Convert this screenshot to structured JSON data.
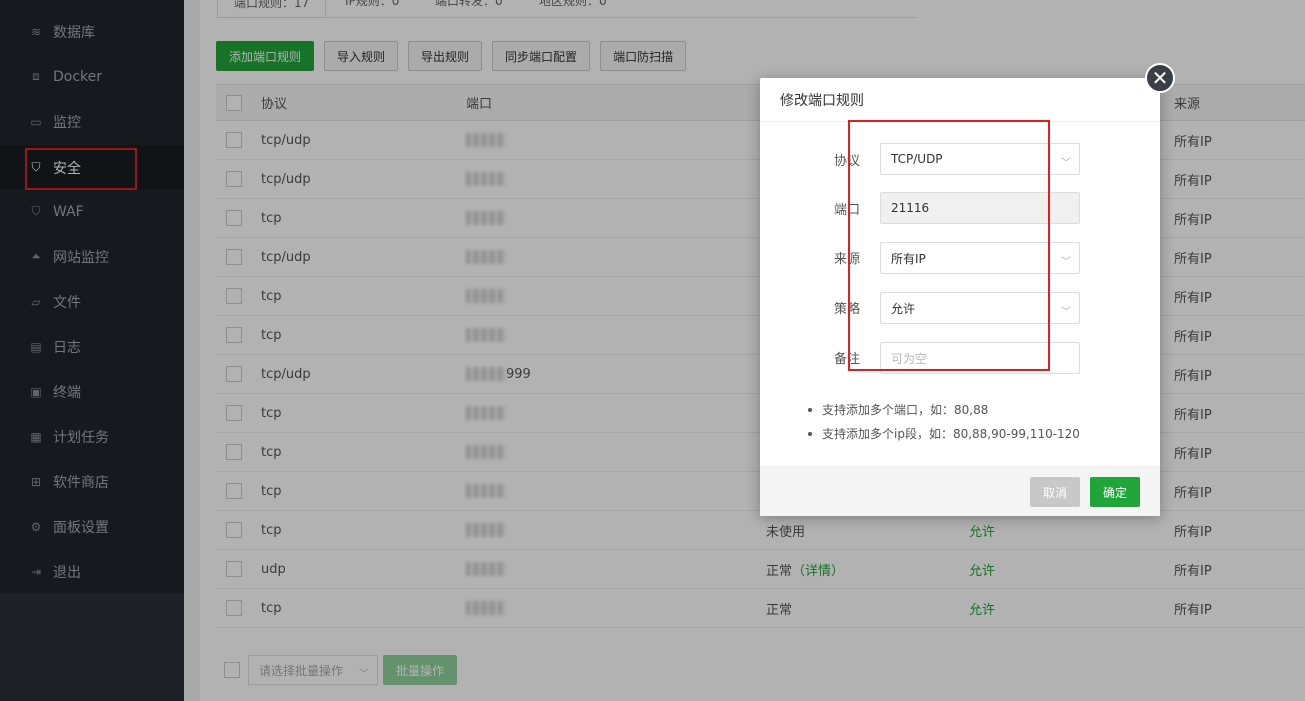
{
  "sidebar": {
    "items": [
      {
        "label": "数据库",
        "icon": "database-icon",
        "glyph": "≋"
      },
      {
        "label": "Docker",
        "icon": "docker-icon",
        "glyph": "⧈"
      },
      {
        "label": "监控",
        "icon": "monitor-icon",
        "glyph": "▭"
      },
      {
        "label": "安全",
        "icon": "shield-icon",
        "glyph": "⛉"
      },
      {
        "label": "WAF",
        "icon": "waf-shield-icon",
        "glyph": "⛉"
      },
      {
        "label": "网站监控",
        "icon": "chart-icon",
        "glyph": "⏶"
      },
      {
        "label": "文件",
        "icon": "folder-icon",
        "glyph": "▱"
      },
      {
        "label": "日志",
        "icon": "log-icon",
        "glyph": "▤"
      },
      {
        "label": "终端",
        "icon": "terminal-icon",
        "glyph": "▣"
      },
      {
        "label": "计划任务",
        "icon": "calendar-icon",
        "glyph": "▦"
      },
      {
        "label": "软件商店",
        "icon": "apps-icon",
        "glyph": "⊞"
      },
      {
        "label": "面板设置",
        "icon": "gear-icon",
        "glyph": "⚙"
      },
      {
        "label": "退出",
        "icon": "logout-icon",
        "glyph": "⇥"
      }
    ]
  },
  "tabs": [
    "端口规则：17",
    "IP规则：0",
    "端口转发：0",
    "地区规则：0"
  ],
  "toolbar": {
    "add": "添加端口规则",
    "import": "导入规则",
    "export": "导出规则",
    "sync": "同步端口配置",
    "scan": "端口防扫描"
  },
  "table": {
    "headers": {
      "protocol": "协议",
      "port": "端口",
      "source": "来源"
    },
    "rows": [
      {
        "protocol": "tcp/udp",
        "port": "",
        "status": "",
        "detail": "",
        "policy": "",
        "source": "所有IP"
      },
      {
        "protocol": "tcp/udp",
        "port": "",
        "status": "",
        "detail": "",
        "policy": "",
        "source": "所有IP"
      },
      {
        "protocol": "tcp",
        "port": "",
        "status": "",
        "detail": "",
        "policy": "",
        "source": "所有IP"
      },
      {
        "protocol": "tcp/udp",
        "port": "",
        "status": "",
        "detail": "",
        "policy": "",
        "source": "所有IP"
      },
      {
        "protocol": "tcp",
        "port": "",
        "status": "",
        "detail": "",
        "policy": "",
        "source": "所有IP"
      },
      {
        "protocol": "tcp",
        "port": "",
        "status": "",
        "detail": "",
        "policy": "",
        "source": "所有IP"
      },
      {
        "protocol": "tcp/udp",
        "port": "999",
        "status": "",
        "detail": "",
        "policy": "",
        "source": "所有IP"
      },
      {
        "protocol": "tcp",
        "port": "",
        "status": "",
        "detail": "",
        "policy": "",
        "source": "所有IP"
      },
      {
        "protocol": "tcp",
        "port": "",
        "status": "",
        "detail": "",
        "policy": "",
        "source": "所有IP"
      },
      {
        "protocol": "tcp",
        "port": "",
        "status": "",
        "detail": "",
        "policy": "",
        "source": "所有IP"
      },
      {
        "protocol": "tcp",
        "port": "",
        "status": "未使用",
        "detail": "",
        "policy": "允许",
        "source": "所有IP"
      },
      {
        "protocol": "udp",
        "port": "",
        "status": "正常",
        "detail": "（详情）",
        "policy": "允许",
        "source": "所有IP"
      },
      {
        "protocol": "tcp",
        "port": "",
        "status": "正常",
        "detail": "",
        "policy": "允许",
        "source": "所有IP"
      }
    ]
  },
  "footer": {
    "batch_placeholder": "请选择批量操作",
    "batch_button": "批量操作"
  },
  "modal": {
    "title": "修改端口规则",
    "protocol_label": "协议",
    "protocol_value": "TCP/UDP",
    "port_label": "端口",
    "port_value": "21116",
    "source_label": "来源",
    "source_value": "所有IP",
    "policy_label": "策略",
    "policy_value": "允许",
    "remark_label": "备注",
    "remark_placeholder": "可为空",
    "tips": [
      "支持添加多个端口，如：80,88",
      "支持添加多个ip段，如：80,88,90-99,110-120"
    ],
    "cancel": "取消",
    "ok": "确定"
  },
  "colors": {
    "accent": "#20a53a",
    "sidebar_bg": "#20262d",
    "highlight_border": "#e02020"
  }
}
